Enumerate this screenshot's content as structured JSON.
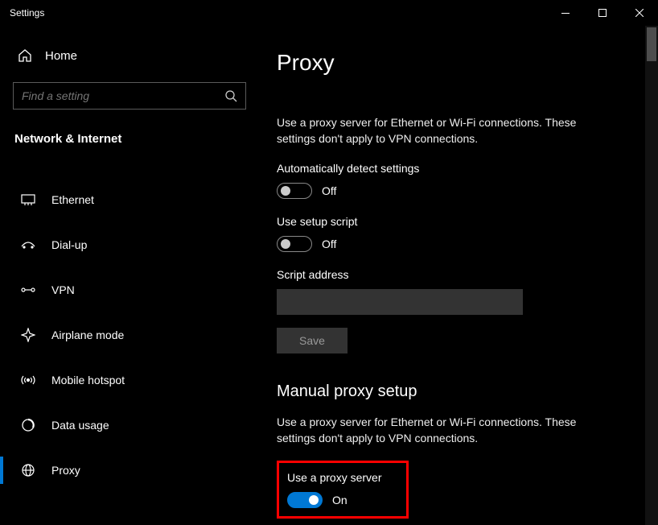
{
  "window": {
    "title": "Settings"
  },
  "sidebar": {
    "home_label": "Home",
    "search_placeholder": "Find a setting",
    "section_label": "Network & Internet",
    "items": [
      {
        "label": "Ethernet"
      },
      {
        "label": "Dial-up"
      },
      {
        "label": "VPN"
      },
      {
        "label": "Airplane mode"
      },
      {
        "label": "Mobile hotspot"
      },
      {
        "label": "Data usage"
      },
      {
        "label": "Proxy"
      }
    ]
  },
  "page": {
    "title": "Proxy",
    "desc1": "Use a proxy server for Ethernet or Wi-Fi connections. These settings don't apply to VPN connections.",
    "auto_detect_label": "Automatically detect settings",
    "auto_detect_state": "Off",
    "use_script_label": "Use setup script",
    "use_script_state": "Off",
    "script_address_label": "Script address",
    "script_address_value": "",
    "save_label": "Save",
    "manual_heading": "Manual proxy setup",
    "desc2": "Use a proxy server for Ethernet or Wi-Fi connections. These settings don't apply to VPN connections.",
    "use_proxy_label": "Use a proxy server",
    "use_proxy_state": "On"
  }
}
